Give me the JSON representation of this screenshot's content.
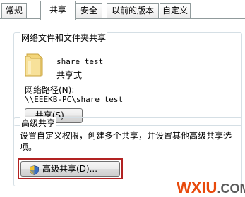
{
  "tabs": [
    {
      "label": "常规"
    },
    {
      "label": "共享"
    },
    {
      "label": "安全"
    },
    {
      "label": "以前的版本"
    },
    {
      "label": "自定义"
    }
  ],
  "network_sharing": {
    "group_title": "网络文件和文件夹共享",
    "folder_name": "share test",
    "share_status": "共享式",
    "network_path_label": "网络路径(N):",
    "network_path_value": "\\\\EEEKB-PC\\share test",
    "share_button_label": "共享(S)..."
  },
  "advanced_sharing": {
    "group_title": "高级共享",
    "description_line1": "设置自定义权限，创建多个共享，并设置其他高级共享选",
    "description_line2": "项。",
    "button_label": "高级共享(D)..."
  },
  "watermark": {
    "part1": "WXIU",
    "part2": ".COM"
  },
  "colors": {
    "highlight": "#b22222",
    "watermark_primary": "#e84a0c",
    "watermark_secondary": "#5a5a5a"
  }
}
